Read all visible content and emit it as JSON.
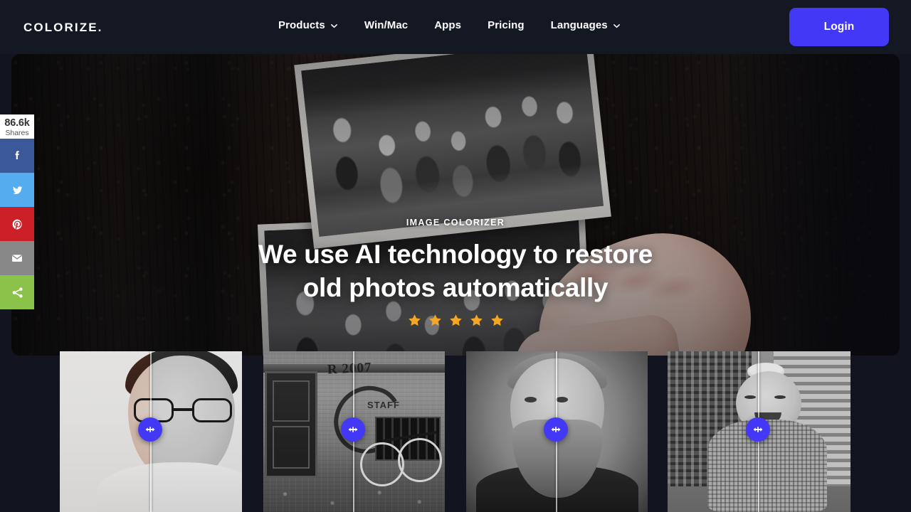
{
  "brand": {
    "logo_text": "COLORIZE."
  },
  "nav": {
    "items": [
      {
        "label": "Products",
        "has_chevron": true,
        "icon": "chevron-down-icon"
      },
      {
        "label": "Win/Mac",
        "has_chevron": false
      },
      {
        "label": "Apps",
        "has_chevron": false
      },
      {
        "label": "Pricing",
        "has_chevron": false
      },
      {
        "label": "Languages",
        "has_chevron": true,
        "icon": "chevron-down-icon"
      }
    ],
    "login_label": "Login",
    "login_color": "#4338f5"
  },
  "share_rail": {
    "count": "86.6k",
    "count_label": "Shares",
    "buttons": [
      {
        "name": "facebook-share-button",
        "icon": "facebook-icon",
        "color": "#3b5998"
      },
      {
        "name": "twitter-share-button",
        "icon": "twitter-icon",
        "color": "#55acee"
      },
      {
        "name": "pinterest-share-button",
        "icon": "pinterest-icon",
        "color": "#cb2027"
      },
      {
        "name": "email-share-button",
        "icon": "envelope-icon",
        "color": "#888888"
      },
      {
        "name": "more-share-button",
        "icon": "share-nodes-icon",
        "color": "#8bc34a"
      }
    ]
  },
  "hero": {
    "eyebrow": "IMAGE COLORIZER",
    "headline_line1": "We use AI technology to restore",
    "headline_line2": "old photos automatically",
    "rating_stars": 5,
    "star_color": "#f5a623",
    "background_description": "hand holding vintage black and white group photographs against dark rusty wood"
  },
  "comparisons": [
    {
      "name": "comparison-card-man-with-glasses",
      "alt": "Portrait of a man wearing glasses, colorized left / black and white right",
      "slider_percent": 50,
      "handle_icon": "left-right-arrows-icon"
    },
    {
      "name": "comparison-card-graffiti-wall",
      "alt": "Graffiti wall with doorway and bicycle",
      "slider_percent": 50,
      "handle_icon": "left-right-arrows-icon"
    },
    {
      "name": "comparison-card-vintage-bearded-man",
      "alt": "Vintage portrait of a bearded gentleman",
      "slider_percent": 50,
      "handle_icon": "left-right-arrows-icon"
    },
    {
      "name": "comparison-card-vintage-baby",
      "alt": "Vintage photo of a smiling baby in a wicker chair",
      "slider_percent": 50,
      "handle_icon": "left-right-arrows-icon"
    }
  ]
}
